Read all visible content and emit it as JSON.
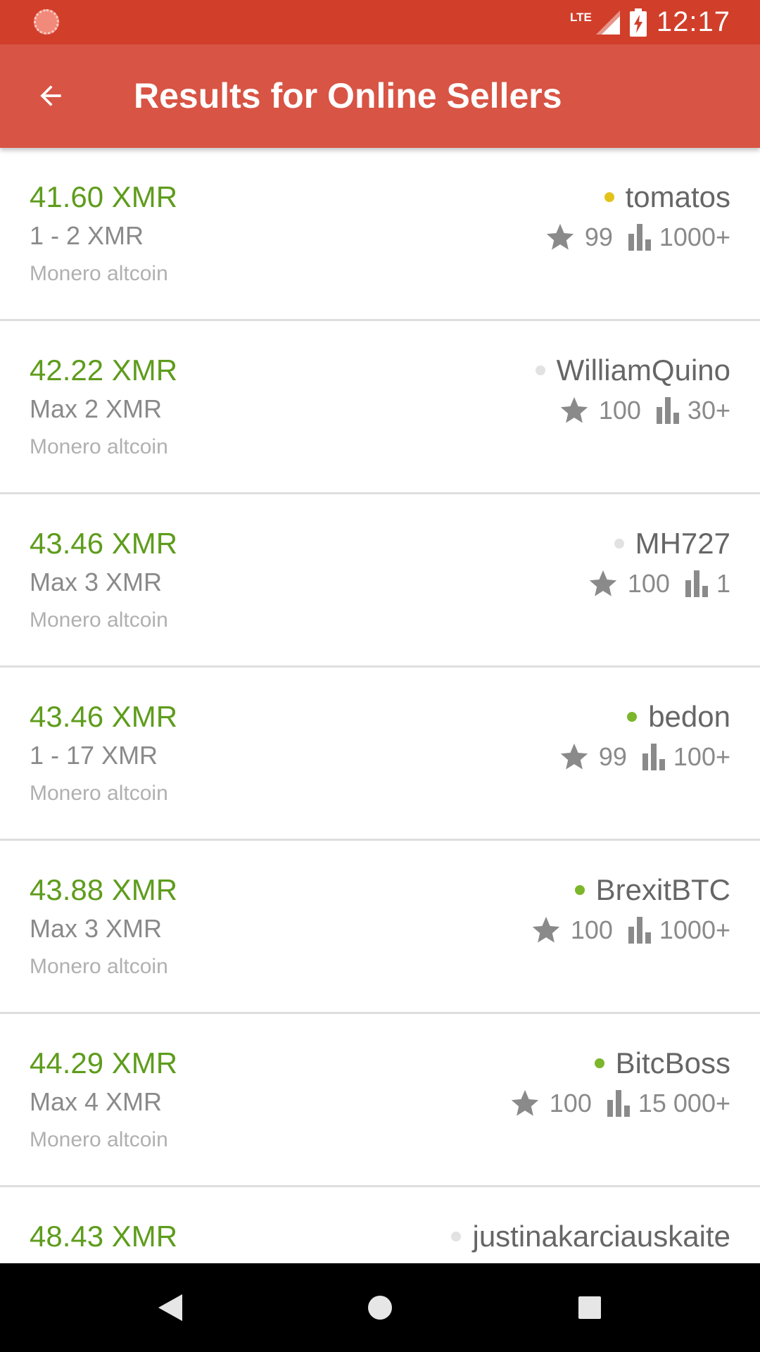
{
  "status_bar": {
    "network": "LTE",
    "time": "12:17"
  },
  "app_bar": {
    "title": "Results for Online Sellers",
    "back_icon": "arrow-back-icon"
  },
  "colors": {
    "accent_red": "#d85444",
    "status_red": "#d13f2a",
    "price_green": "#5e9c1c",
    "online_green": "#7cb62a",
    "recently_online_yellow": "#e3c21a",
    "offline_gray": "#e2e2e2"
  },
  "listings": [
    {
      "price": "41.60 XMR",
      "limit": "1 - 2 XMR",
      "method": "Monero altcoin",
      "seller": "tomatos",
      "status_color": "#e3c21a",
      "feedback": "99",
      "trades": "1000+"
    },
    {
      "price": "42.22 XMR",
      "limit": "Max 2 XMR",
      "method": "Monero altcoin",
      "seller": "WilliamQuino",
      "status_color": "#e2e2e2",
      "feedback": "100",
      "trades": "30+"
    },
    {
      "price": "43.46 XMR",
      "limit": "Max 3 XMR",
      "method": "Monero altcoin",
      "seller": "MH727",
      "status_color": "#e2e2e2",
      "feedback": "100",
      "trades": "1"
    },
    {
      "price": "43.46 XMR",
      "limit": "1 - 17 XMR",
      "method": "Monero altcoin",
      "seller": "bedon",
      "status_color": "#7cb62a",
      "feedback": "99",
      "trades": "100+"
    },
    {
      "price": "43.88 XMR",
      "limit": "Max 3 XMR",
      "method": "Monero altcoin",
      "seller": "BrexitBTC",
      "status_color": "#7cb62a",
      "feedback": "100",
      "trades": "1000+"
    },
    {
      "price": "44.29 XMR",
      "limit": "Max 4 XMR",
      "method": "Monero altcoin",
      "seller": "BitcBoss",
      "status_color": "#7cb62a",
      "feedback": "100",
      "trades": "15 000+"
    },
    {
      "price": "48.43 XMR",
      "limit": "",
      "method": "",
      "seller": "justinakarciauskaite",
      "status_color": "#e2e2e2",
      "feedback": "",
      "trades": ""
    }
  ],
  "nav_bar": {
    "back_icon": "nav-back-triangle-icon",
    "home_icon": "nav-home-circle-icon",
    "recents_icon": "nav-recents-square-icon"
  }
}
